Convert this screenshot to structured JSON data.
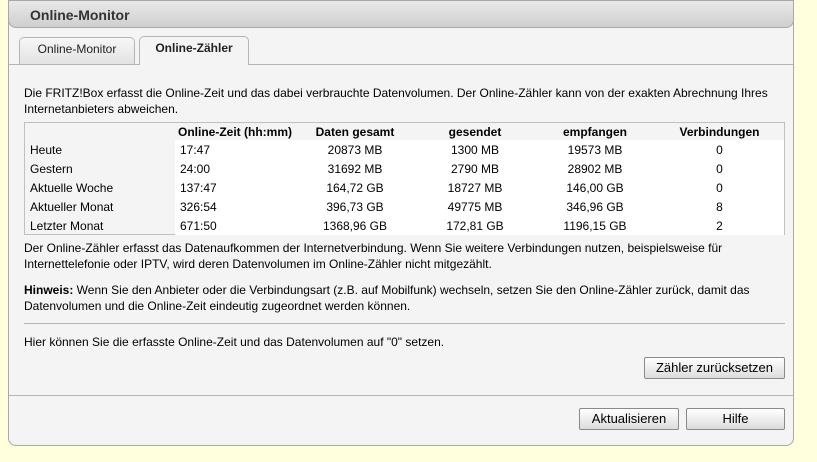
{
  "window": {
    "title": "Online-Monitor"
  },
  "tabs": [
    {
      "label": "Online-Monitor"
    },
    {
      "label": "Online-Zähler"
    }
  ],
  "intro": "Die FRITZ!Box erfasst die Online-Zeit und das dabei verbrauchte Datenvolumen. Der Online-Zähler kann von der exakten Abrechnung Ihres Internetanbieters abweichen.",
  "table": {
    "headers": [
      "",
      "Online-Zeit (hh:mm)",
      "Daten gesamt",
      "gesendet",
      "empfangen",
      "Verbindungen"
    ],
    "rows": [
      [
        "Heute",
        "17:47",
        "20873 MB",
        "1300 MB",
        "19573 MB",
        "0"
      ],
      [
        "Gestern",
        "24:00",
        "31692 MB",
        "2790 MB",
        "28902 MB",
        "0"
      ],
      [
        "Aktuelle Woche",
        "137:47",
        "164,72 GB",
        "18727 MB",
        "146,00 GB",
        "0"
      ],
      [
        "Aktueller Monat",
        "326:54",
        "396,73 GB",
        "49775 MB",
        "346,96 GB",
        "8"
      ],
      [
        "Letzter Monat",
        "671:50",
        "1368,96 GB",
        "172,81 GB",
        "1196,15 GB",
        "2"
      ]
    ]
  },
  "note": "Der Online-Zähler erfasst das Datenaufkommen der Internetverbindung. Wenn Sie weitere Verbindungen nutzen, beispielsweise für Internettelefonie oder IPTV, wird deren Datenvolumen im Online-Zähler nicht mitgezählt.",
  "hint": {
    "label": "Hinweis:",
    "text": " Wenn Sie den Anbieter oder die Verbindungsart (z.B. auf Mobilfunk) wechseln, setzen Sie den Online-Zähler zurück, damit das Datenvolumen und die Online-Zeit eindeutig zugeordnet werden können."
  },
  "reset": {
    "text": "Hier können Sie die erfasste Online-Zeit und das Datenvolumen auf \"0\" setzen.",
    "button": "Zähler zurücksetzen"
  },
  "footer": {
    "refresh_button": "Aktualisieren",
    "help_button": "Hilfe"
  }
}
